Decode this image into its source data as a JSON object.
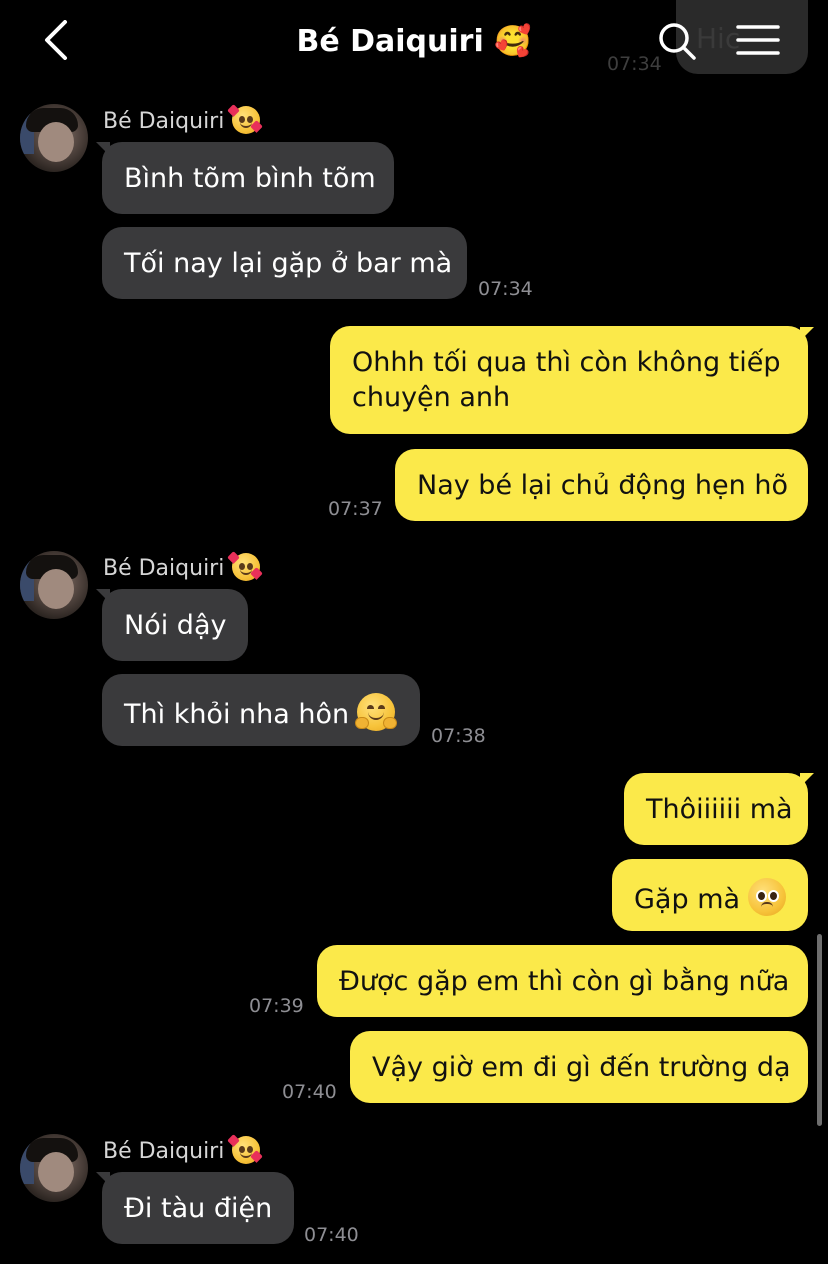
{
  "header": {
    "title": "Bé Daiquiri 🥰",
    "ghost_text": "Hic",
    "ghost_time": "07:34"
  },
  "groups": [
    {
      "sender": "Bé Daiquiri",
      "messages": [
        {
          "text": "Bình tõm bình tõm"
        },
        {
          "text": "Tối nay lại gặp ở bar mà",
          "time": "07:34"
        }
      ]
    },
    {
      "messages": [
        {
          "line1": "Ohhh tối qua thì còn không tiếp",
          "line2": "chuyện anh"
        },
        {
          "text": "Nay bé lại chủ động hẹn hõ",
          "time": "07:37"
        }
      ]
    },
    {
      "sender": "Bé Daiquiri",
      "messages": [
        {
          "text": "Nói dậy"
        },
        {
          "text": "Thì khỏi nha hôn",
          "time": "07:38"
        }
      ]
    },
    {
      "messages": [
        {
          "text": "Thôiiiiii mà"
        },
        {
          "text": "Gặp mà"
        },
        {
          "text": "Được gặp em thì còn gì bằng nữa",
          "time": "07:39"
        },
        {
          "text": "Vậy giờ em đi gì đến trường dạ",
          "time": "07:40"
        }
      ]
    },
    {
      "sender": "Bé Daiquiri",
      "messages": [
        {
          "text": "Đi tàu điện",
          "time": "07:40"
        }
      ]
    }
  ],
  "colors": {
    "background": "#000000",
    "incoming_bubble": "#3a3a3c",
    "outgoing_bubble": "#fbe94a",
    "timestamp": "#8e8e93"
  },
  "icons": [
    "back-chevron-icon",
    "search-icon",
    "menu-icon",
    "smiling-face-with-hearts-emoji",
    "hugging-face-emoji",
    "pleading-face-emoji"
  ]
}
